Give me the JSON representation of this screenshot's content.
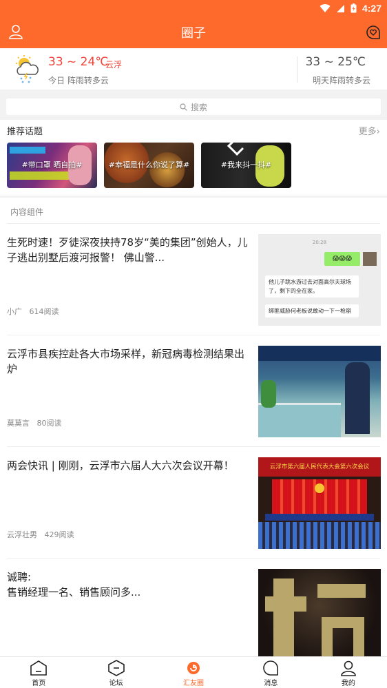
{
  "status": {
    "time": "4:27"
  },
  "header": {
    "title": "圈子"
  },
  "weather": {
    "today_temp": "33 ~ 24℃",
    "city": "云浮",
    "today_desc": "今日 阵雨转多云",
    "tomorrow_temp": "33 ~ 25℃",
    "tomorrow_desc": "明天阵雨转多云"
  },
  "search": {
    "placeholder": "搜索"
  },
  "topics": {
    "heading": "推荐话题",
    "more": "更多",
    "items": [
      {
        "label": "#带口罩 晒自拍#"
      },
      {
        "label": "#幸福是什么你说了算#"
      },
      {
        "label": "#我来抖一抖#"
      }
    ]
  },
  "feed": {
    "heading": "内容组件",
    "articles": [
      {
        "title": "生死时速！歹徒深夜挟持78岁“美的集团”创始人，儿子逃出别墅后渡河报警！ 佛山警...",
        "author": "小广",
        "reads": "614阅读"
      },
      {
        "title": "云浮市县疾控赴各大市场采样，新冠病毒检测结果出炉",
        "author": "莫莫言",
        "reads": "80阅读"
      },
      {
        "title": "两会快讯 | 刚刚，云浮市六届人大六次会议开幕！",
        "author": "云浮壮男",
        "reads": "429阅读"
      },
      {
        "title": "诚聘:\n售销经理一名、销售顾问多...",
        "author": "",
        "reads": ""
      }
    ],
    "chat_thumb": {
      "time": "20:28",
      "bubble1": "他儿子跳水游过去对面高尔夫球场了，剩下的全在家。",
      "bubble2": "绑匪威胁何老板说敢动一下一枪崩"
    },
    "meeting_banner": "云浮市第六届人民代表大会第六次会议"
  },
  "tabbar": {
    "items": [
      {
        "label": "首页"
      },
      {
        "label": "论坛"
      },
      {
        "label": "汇友圈"
      },
      {
        "label": "消息"
      },
      {
        "label": "我的"
      }
    ]
  },
  "colors": {
    "brand": "#fe6a2b",
    "temp_red": "#f0453b"
  }
}
